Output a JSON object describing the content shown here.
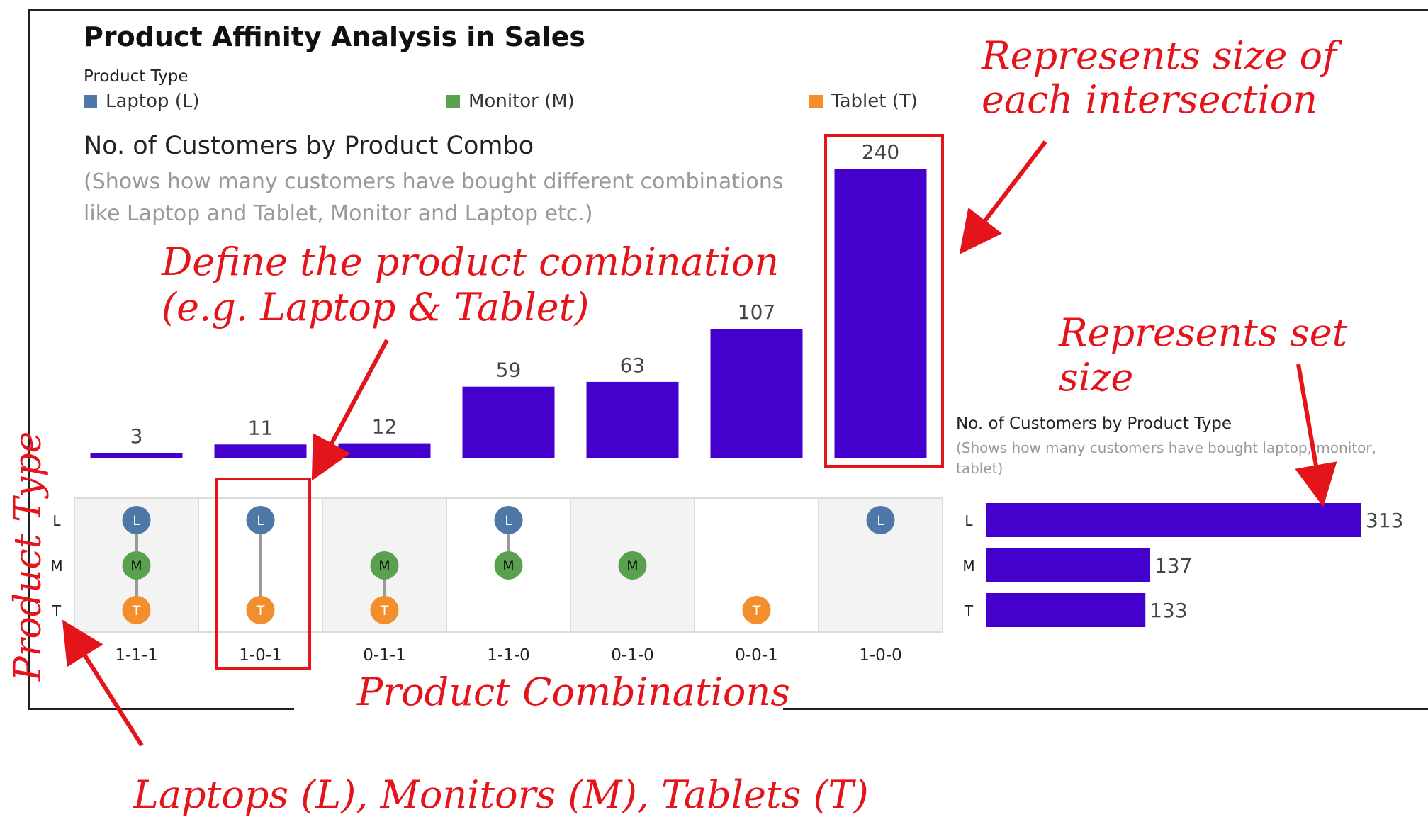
{
  "title": "Product Affinity Analysis in Sales",
  "legend": {
    "title": "Product Type",
    "items": [
      {
        "label": "Laptop (L)",
        "color": "#4e79a7"
      },
      {
        "label": "Monitor (M)",
        "color": "#59a14f"
      },
      {
        "label": "Tablet (T)",
        "color": "#f28e2b"
      }
    ]
  },
  "combo_chart": {
    "title": "No. of Customers by Product Combo",
    "note": "(Shows how many customers have bought different combinations like Laptop and Tablet, Monitor and Laptop etc.)"
  },
  "set_chart": {
    "title": "No. of Customers by Product Type",
    "note": "(Shows how many customers have bought laptop, monitor, tablet)"
  },
  "annotations": {
    "intersection": "Represents size of each intersection",
    "combination": "Define the product combination (e.g. Laptop & Tablet)",
    "set_size": "Represents set size",
    "product_type": "Product Type",
    "product_combinations": "Product Combinations",
    "types": "Laptops (L), Monitors (M), Tablets (T)"
  },
  "colors": {
    "bar": "#4400cc",
    "highlight": "#e4141b",
    "connector": "#9a9a9a",
    "matrix_shade": "#f3f3f3"
  },
  "chart_data": [
    {
      "type": "bar",
      "title": "No. of Customers by Product Combo",
      "categories": [
        "1-1-1",
        "1-0-1",
        "0-1-1",
        "1-1-0",
        "0-1-0",
        "0-0-1",
        "1-0-0"
      ],
      "values": [
        3,
        11,
        12,
        59,
        63,
        107,
        240
      ],
      "membership_rows": [
        "L",
        "M",
        "T"
      ],
      "membership": [
        [
          1,
          1,
          1
        ],
        [
          1,
          0,
          1
        ],
        [
          0,
          1,
          1
        ],
        [
          1,
          1,
          0
        ],
        [
          0,
          1,
          0
        ],
        [
          0,
          0,
          1
        ],
        [
          1,
          0,
          0
        ]
      ],
      "ylim": [
        0,
        240
      ]
    },
    {
      "type": "bar",
      "orientation": "horizontal",
      "title": "No. of Customers by Product Type",
      "categories": [
        "L",
        "M",
        "T"
      ],
      "values": [
        313,
        137,
        133
      ]
    }
  ]
}
